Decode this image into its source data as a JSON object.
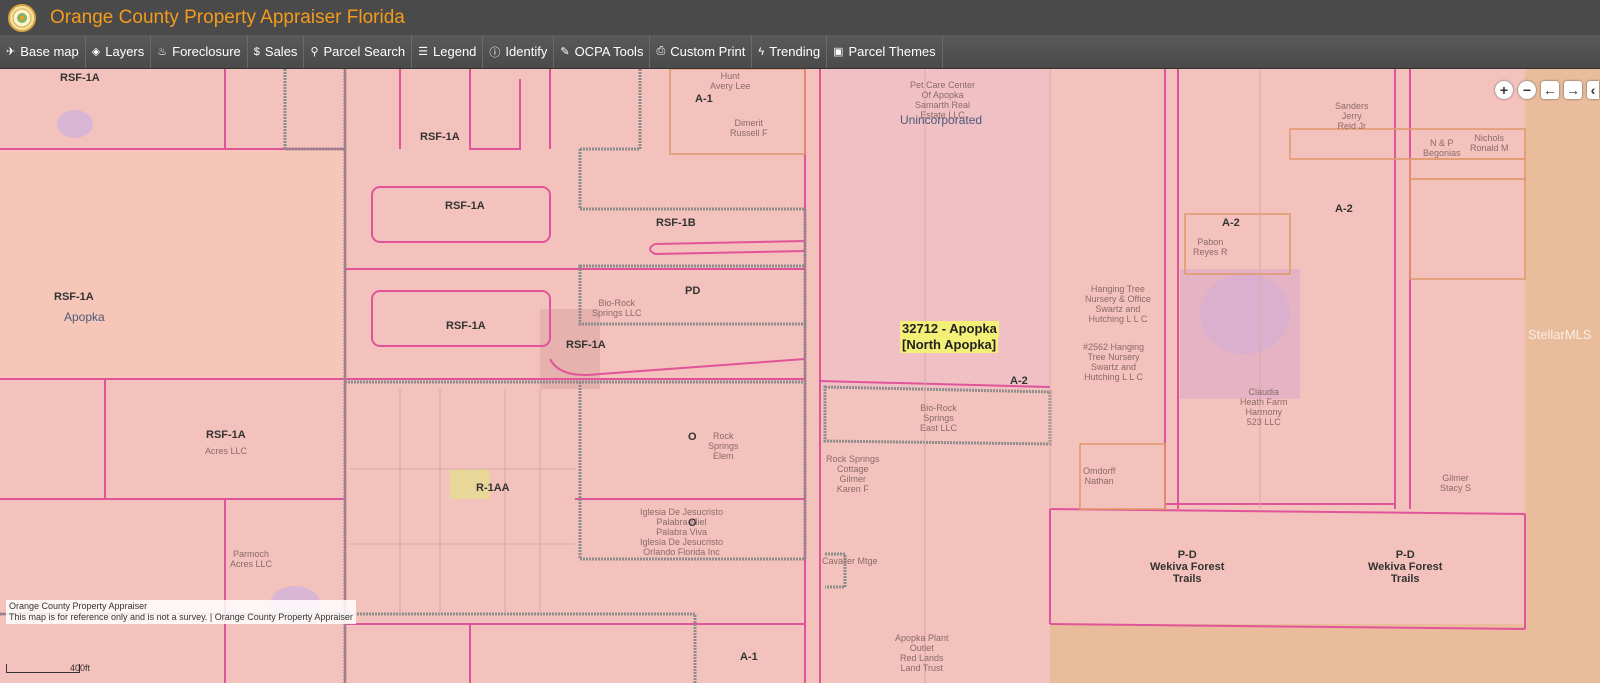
{
  "app": {
    "title": "Orange County Property Appraiser Florida"
  },
  "toolbar": [
    {
      "label": "Base map",
      "icon": "plane-icon",
      "glyph": "✈"
    },
    {
      "label": "Layers",
      "icon": "layers-icon",
      "glyph": "◈"
    },
    {
      "label": "Foreclosure",
      "icon": "flame-icon",
      "glyph": "♨"
    },
    {
      "label": "Sales",
      "icon": "dollar-icon",
      "glyph": "$"
    },
    {
      "label": "Parcel Search",
      "icon": "search-icon",
      "glyph": "⚲"
    },
    {
      "label": "Legend",
      "icon": "list-icon",
      "glyph": "☰"
    },
    {
      "label": "Identify",
      "icon": "info-icon",
      "glyph": "ⓘ"
    },
    {
      "label": "OCPA Tools",
      "icon": "wrench-icon",
      "glyph": "✎"
    },
    {
      "label": "Custom Print",
      "icon": "print-icon",
      "glyph": "⎙"
    },
    {
      "label": "Trending",
      "icon": "bolt-icon",
      "glyph": "ϟ"
    },
    {
      "label": "Parcel Themes",
      "icon": "image-icon",
      "glyph": "▣"
    }
  ],
  "map": {
    "zoning_labels": [
      "RSF-1A",
      "A-1",
      "RSF-1A",
      "RSF-1A",
      "RSF-1B",
      "RSF-1A",
      "PD",
      "RSF-1A",
      "RSF-1A",
      "A-2",
      "RSF-1A",
      "O",
      "R-1AA",
      "O",
      "A-2",
      "A-2",
      "A-1"
    ],
    "owner_labels": [
      "Pet Care Center\nOf Apopka\nSamarth Real\nEstate LLC",
      "Hunt\nAvery Lee",
      "Dimerit\nRussell F",
      "Sanders\nJerry\nReid Jr",
      "N & P\nBegonias",
      "Nichols\nRonald M",
      "Pabon\nReyes R",
      "Hanging Tree\nNursery & Office\nSwartz and\nHutching L L C",
      "#2562 Hanging\nTree Nursery\nSwartz and\nHutching L L C",
      "Claudia\nHeath Farm\nHarmony\n523 LLC",
      "Bio-Rock\nSprings LLC",
      "Bio-Rock\nSprings\nEast LLC",
      "Rock\nSprings\nElem",
      "Rock Springs\nCottage\nGilmer\nKaren F",
      "Omdorff\nNathan",
      "Gilmer\nStacy S",
      "Iglesia De Jesucristo\nPalabra Miel\nPalabra Viva\nIglesia De Jesucristo\nOrlando Florida Inc",
      "Parmoch\nAcres LLC",
      "Acres LLC",
      "Apopka Plant\nOutlet\nRed Lands\nLand Trust",
      "Cavalier Mtge"
    ],
    "places": [
      "Unincorporated",
      "Apopka"
    ],
    "zip_label_line1": "32712 - Apopka",
    "zip_label_line2": "[North Apopka]",
    "pd_labels": [
      {
        "line1": "P-D",
        "line2": "Wekiva Forest",
        "line3": "Trails"
      },
      {
        "line1": "P-D",
        "line2": "Wekiva Forest",
        "line3": "Trails"
      }
    ],
    "watermark": "StellarMLS"
  },
  "nav": {
    "zoom_in": "+",
    "zoom_out": "−",
    "pan_left": "←",
    "pan_right": "→",
    "collapse": "‹"
  },
  "attribution": {
    "line1": "Orange County Property Appraiser",
    "line2": "This map is for reference only and is not a survey. | Orange County Property Appraiser"
  },
  "scale": {
    "label": "400ft"
  }
}
